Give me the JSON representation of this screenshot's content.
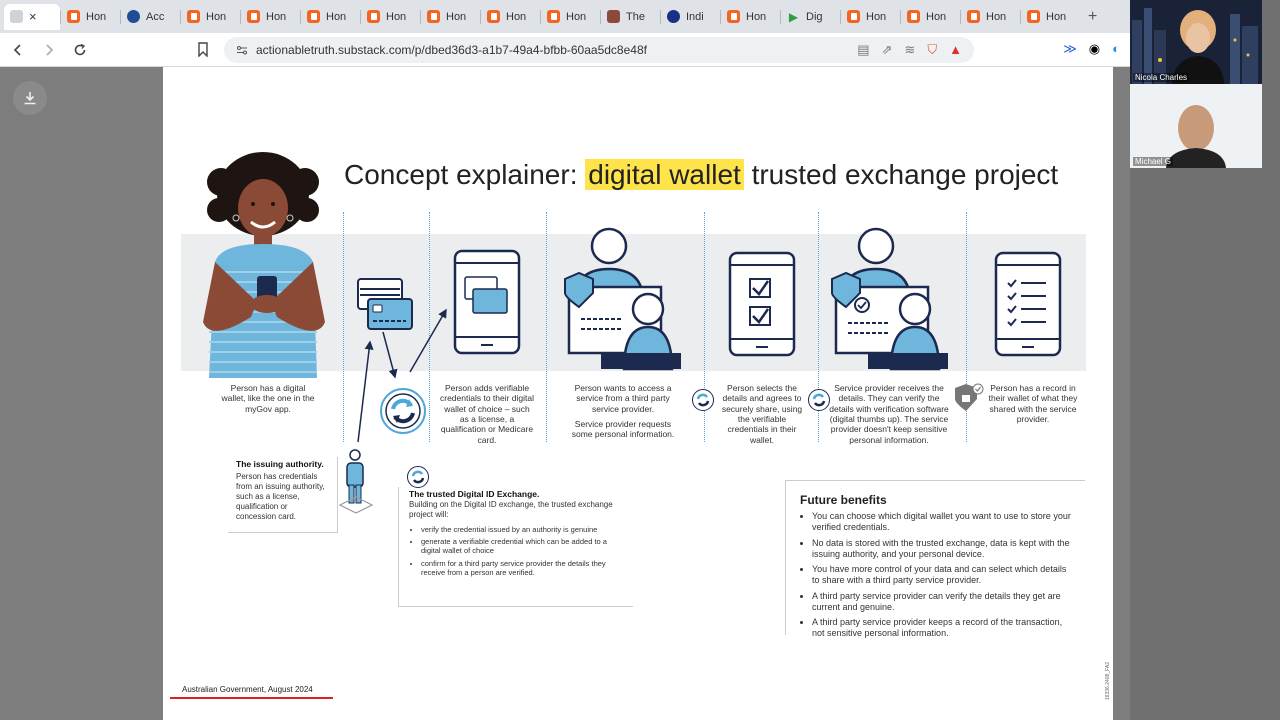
{
  "browser": {
    "tabs": [
      {
        "label": "",
        "icon": "blank-page-icon",
        "active": true
      },
      {
        "label": "Hon",
        "icon": "substack-icon"
      },
      {
        "label": "Acc",
        "icon": "gov-crest-icon"
      },
      {
        "label": "Hon",
        "icon": "substack-icon"
      },
      {
        "label": "Hon",
        "icon": "substack-icon"
      },
      {
        "label": "Hon",
        "icon": "substack-icon"
      },
      {
        "label": "Hon",
        "icon": "substack-icon"
      },
      {
        "label": "Hon",
        "icon": "substack-icon"
      },
      {
        "label": "Hon",
        "icon": "substack-icon"
      },
      {
        "label": "Hon",
        "icon": "substack-icon"
      },
      {
        "label": "The",
        "icon": "thumbnail-icon"
      },
      {
        "label": "Indi",
        "icon": "star-badge-icon"
      },
      {
        "label": "Hon",
        "icon": "substack-icon"
      },
      {
        "label": "Dig",
        "icon": "play-icon"
      },
      {
        "label": "Hon",
        "icon": "substack-icon"
      },
      {
        "label": "Hon",
        "icon": "substack-icon"
      },
      {
        "label": "Hon",
        "icon": "substack-icon"
      },
      {
        "label": "Hon",
        "icon": "substack-icon"
      }
    ],
    "url": "actionabletruth.substack.com/p/dbed36d3-a1b7-49a4-bfbb-60aa5dc8e48f",
    "new_tab_symbol": "+",
    "close_symbol": "×"
  },
  "slide": {
    "title_prefix": "Concept explainer: ",
    "title_highlight": "digital wallet",
    "title_suffix": " trusted exchange project",
    "captions": {
      "person_wallet": "Person has a digital wallet, like the one in the myGov app.",
      "adds_credentials": "Person adds verifiable credentials to their digital wallet of choice – such as a license, a qualification or Medicare card.",
      "wants_access": "Person wants to access a service from a third party service provider.",
      "provider_requests": "Service provider requests some personal information.",
      "selects_details": "Person selects the details and agrees to securely share, using the verifiable credentials in their wallet.",
      "provider_receives": "Service provider receives the details. They can verify the details with verification software (digital thumbs up). The service provider doesn't keep sensitive personal information.",
      "person_record": "Person has a record in their wallet of what they shared with the service provider."
    },
    "issuing": {
      "title": "The issuing authority.",
      "body": "Person has credentials from an issuing authority, such as a license, qualification or concession card."
    },
    "exchange": {
      "title": "The trusted Digital ID Exchange.",
      "intro": "Building on the Digital ID exchange, the trusted exchange project will:",
      "bullets": [
        "verify the credential issued by an authority is genuine",
        "generate a verifiable credential which can be added to a digital wallet of choice",
        "confirm for a third party service provider the details they receive from a person are verified."
      ]
    },
    "future": {
      "title": "Future benefits",
      "bullets": [
        "You can choose which digital wallet you want to use to store your verified credentials.",
        "No data is stored with the trusted exchange, data is kept with the issuing authority, and your personal device.",
        "You have more control of your data and can select which details to share with a third party service provider.",
        "A third party service provider can verify the details they get are current and genuine.",
        "A third party service provider keeps a record of the transaction, not sensitive personal information."
      ]
    },
    "source": "Australian Government, August 2024",
    "code": "16336.2408_FA2"
  },
  "video": {
    "participants": [
      {
        "name": "Nicola Charles"
      },
      {
        "name": "Michael G"
      }
    ]
  },
  "colors": {
    "accent_blue": "#4ea7d8",
    "navy": "#1b2a4e",
    "highlight": "#ffe34a",
    "substack_orange": "#f26522",
    "red_underline": "#e02020"
  }
}
